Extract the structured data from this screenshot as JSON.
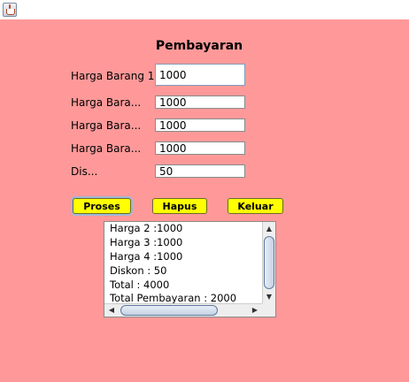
{
  "form": {
    "title": "Pembayaran",
    "fields": [
      {
        "label": "Harga Barang 1",
        "value": "1000"
      },
      {
        "label": "Harga Bara...",
        "value": "1000"
      },
      {
        "label": "Harga Bara...",
        "value": "1000"
      },
      {
        "label": "Harga Bara...",
        "value": "1000"
      },
      {
        "label": "Dis...",
        "value": "50"
      }
    ]
  },
  "buttons": {
    "proses": "Proses",
    "hapus": "Hapus",
    "keluar": "Keluar"
  },
  "output": {
    "lines": [
      "Harga 2 :1000",
      "Harga 3 :1000",
      "Harga 4 :1000",
      "Diskon : 50",
      "Total : 4000",
      "Total Pembayaran : 2000"
    ]
  },
  "colors": {
    "background": "#ff9999",
    "button": "#ffff00"
  },
  "icons": {
    "app_icon": "java-coffee-cup-icon"
  }
}
